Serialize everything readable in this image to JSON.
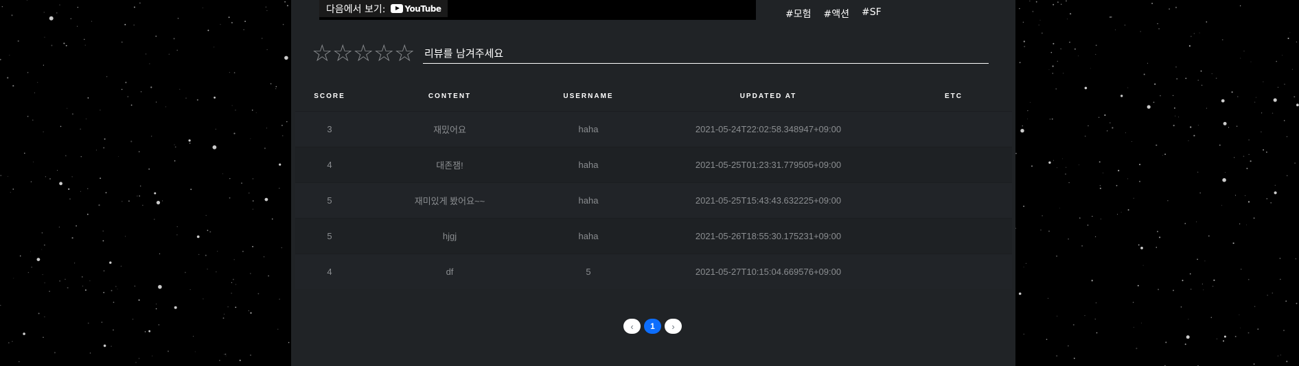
{
  "video": {
    "watch_on_label": "다음에서 보기:",
    "logo_text": "YouTube"
  },
  "tags": [
    "#모험",
    "#액션",
    "#SF"
  ],
  "review": {
    "stars": [
      "☆",
      "☆",
      "☆",
      "☆",
      "☆"
    ],
    "placeholder": "리뷰를 남겨주세요"
  },
  "table": {
    "headers": [
      "SCORE",
      "CONTENT",
      "USERNAME",
      "UPDATED AT",
      "ETC"
    ],
    "rows": [
      {
        "score": "3",
        "content": "재밌어요",
        "username": "haha",
        "updated_at": "2021-05-24T22:02:58.348947+09:00",
        "etc": ""
      },
      {
        "score": "4",
        "content": "대존잼!",
        "username": "haha",
        "updated_at": "2021-05-25T01:23:31.779505+09:00",
        "etc": ""
      },
      {
        "score": "5",
        "content": "재미있게 봤어요~~",
        "username": "haha",
        "updated_at": "2021-05-25T15:43:43.632225+09:00",
        "etc": ""
      },
      {
        "score": "5",
        "content": "hjgj",
        "username": "haha",
        "updated_at": "2021-05-26T18:55:30.175231+09:00",
        "etc": ""
      },
      {
        "score": "4",
        "content": "df",
        "username": "5",
        "updated_at": "2021-05-27T10:15:04.669576+09:00",
        "etc": ""
      }
    ]
  },
  "pagination": {
    "prev": "‹",
    "current": "1",
    "next": "›"
  },
  "colors": {
    "panel": "#202326",
    "active_page": "#0d6efd",
    "muted_text": "#8b8e91"
  }
}
